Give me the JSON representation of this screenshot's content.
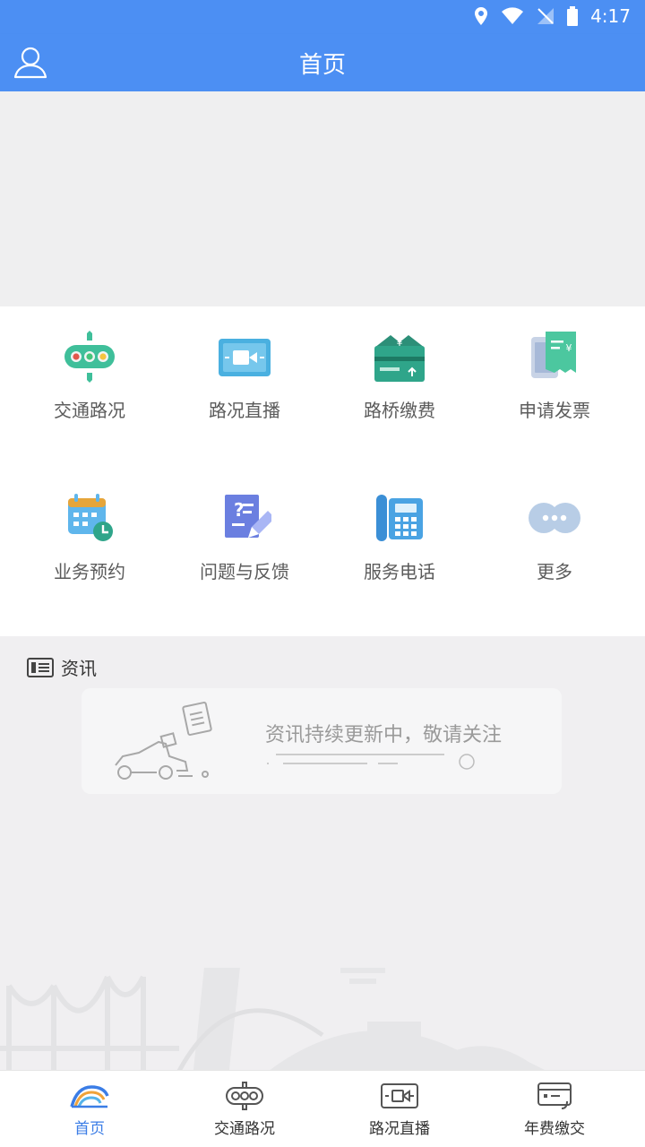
{
  "status_bar": {
    "time": "4:17"
  },
  "header": {
    "title": "首页"
  },
  "grid": {
    "items": [
      {
        "label": "交通路况",
        "icon": "traffic-light-icon"
      },
      {
        "label": "路况直播",
        "icon": "video-camera-icon"
      },
      {
        "label": "路桥缴费",
        "icon": "toll-payment-icon"
      },
      {
        "label": "申请发票",
        "icon": "invoice-icon"
      },
      {
        "label": "业务预约",
        "icon": "calendar-icon"
      },
      {
        "label": "问题与反馈",
        "icon": "feedback-edit-icon"
      },
      {
        "label": "服务电话",
        "icon": "telephone-icon"
      },
      {
        "label": "更多",
        "icon": "more-dots-icon"
      }
    ]
  },
  "news": {
    "title": "资讯",
    "empty_text": "资讯持续更新中，敬请关注"
  },
  "tabbar": {
    "active_index": 0,
    "active_color": "#3b7de6",
    "tabs": [
      {
        "label": "首页",
        "icon": "home-road-icon"
      },
      {
        "label": "交通路况",
        "icon": "traffic-light-icon"
      },
      {
        "label": "路况直播",
        "icon": "video-camera-icon"
      },
      {
        "label": "年费缴交",
        "icon": "card-payment-icon"
      }
    ]
  },
  "colors": {
    "primary": "#4c8ff3",
    "page_bg": "#f0eff1"
  }
}
